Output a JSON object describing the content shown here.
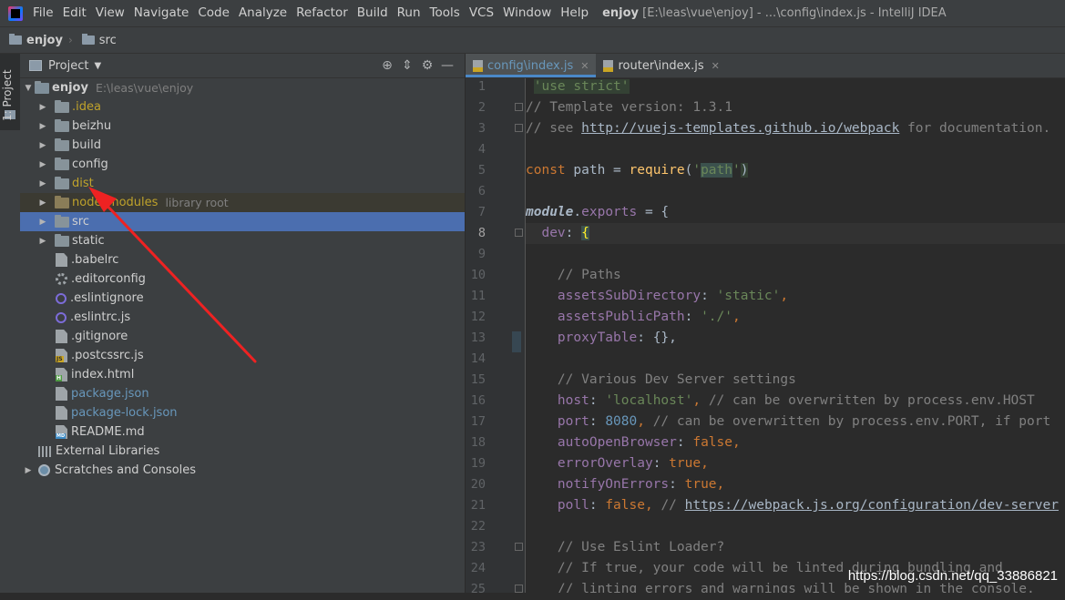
{
  "menubar": {
    "items": [
      {
        "label": "File"
      },
      {
        "label": "Edit"
      },
      {
        "label": "View"
      },
      {
        "label": "Navigate"
      },
      {
        "label": "Code"
      },
      {
        "label": "Analyze"
      },
      {
        "label": "Refactor"
      },
      {
        "label": "Build"
      },
      {
        "label": "Run"
      },
      {
        "label": "Tools"
      },
      {
        "label": "VCS"
      },
      {
        "label": "Window"
      },
      {
        "label": "Help"
      }
    ],
    "project_name": "enjoy",
    "title_rest": "[E:\\leas\\vue\\enjoy] - ...\\config\\index.js - IntelliJ IDEA"
  },
  "navbar": {
    "crumbs": [
      {
        "label": "enjoy"
      },
      {
        "label": "src"
      }
    ]
  },
  "toolstrip": {
    "label": "1: Project"
  },
  "panel": {
    "title": "Project"
  },
  "tree": {
    "root": {
      "label": "enjoy",
      "path": "E:\\leas\\vue\\enjoy"
    },
    "items": [
      {
        "label": ".idea"
      },
      {
        "label": "beizhu"
      },
      {
        "label": "build"
      },
      {
        "label": "config"
      },
      {
        "label": "dist"
      },
      {
        "label": "node_modules",
        "hint": "library root"
      },
      {
        "label": "src"
      },
      {
        "label": "static"
      },
      {
        "label": ".babelrc"
      },
      {
        "label": ".editorconfig"
      },
      {
        "label": ".eslintignore"
      },
      {
        "label": ".eslintrc.js"
      },
      {
        "label": ".gitignore"
      },
      {
        "label": ".postcssrc.js"
      },
      {
        "label": "index.html"
      },
      {
        "label": "package.json"
      },
      {
        "label": "package-lock.json"
      },
      {
        "label": "README.md"
      }
    ],
    "external": "External Libraries",
    "scratches": "Scratches and Consoles"
  },
  "tabs": [
    {
      "label": "config\\index.js"
    },
    {
      "label": "router\\index.js"
    }
  ],
  "editor": {
    "line_numbers": [
      "1",
      "2",
      "3",
      "4",
      "5",
      "6",
      "7",
      "8",
      "9",
      "10",
      "11",
      "12",
      "13",
      "14",
      "15",
      "16",
      "17",
      "18",
      "19",
      "20",
      "21",
      "22",
      "23",
      "24",
      "25"
    ],
    "current_line": 8,
    "lines": {
      "l1": "'use strict'",
      "l2": "// Template version: 1.3.1",
      "l3a": "// see ",
      "l3b": "http://vuejs-templates.github.io/webpack",
      "l3c": " for documentation.",
      "l5a": "const",
      "l5b": " path = ",
      "l5c": "require",
      "l5d": "(",
      "l5e": "'",
      "l5f": "path",
      "l5g": "'",
      "l5h": ")",
      "l7a": "module",
      "l7b": ".",
      "l7c": "exports",
      "l7d": " = {",
      "l8a": "  ",
      "l8b": "dev",
      "l8c": ": ",
      "l8d": "{",
      "l10": "    // Paths",
      "l11a": "assetsSubDirectory",
      "l11b": ": ",
      "l11c": "'static'",
      "l11d": ",",
      "l12a": "assetsPublicPath",
      "l12b": ": ",
      "l12c": "'./'",
      "l12d": ",",
      "l13a": "proxyTable",
      "l13b": ": {},",
      "l15": "    // Various Dev Server settings",
      "l16a": "host",
      "l16b": ": ",
      "l16c": "'localhost'",
      "l16d": ", ",
      "l16e": "// can be overwritten by process.env.HOST",
      "l17a": "port",
      "l17b": ": ",
      "l17c": "8080",
      "l17d": ", ",
      "l17e": "// can be overwritten by process.env.PORT, if port",
      "l18a": "autoOpenBrowser",
      "l18b": ": ",
      "l18c": "false",
      "l18d": ",",
      "l19a": "errorOverlay",
      "l19b": ": ",
      "l19c": "true",
      "l19d": ",",
      "l20a": "notifyOnErrors",
      "l20b": ": ",
      "l20c": "true",
      "l20d": ",",
      "l21a": "poll",
      "l21b": ": ",
      "l21c": "false",
      "l21d": ", ",
      "l21e": "// ",
      "l21f": "https://webpack.js.org/configuration/dev-server",
      "l23": "    // Use Eslint Loader?",
      "l24": "    // If true, your code will be linted during bundling and",
      "l25": "    // linting errors and warnings will be shown in the console."
    }
  },
  "watermark": "https://blog.csdn.net/qq_33886821",
  "colors": {
    "arrow": "#ee2222",
    "selection": "#4b6eaf"
  }
}
